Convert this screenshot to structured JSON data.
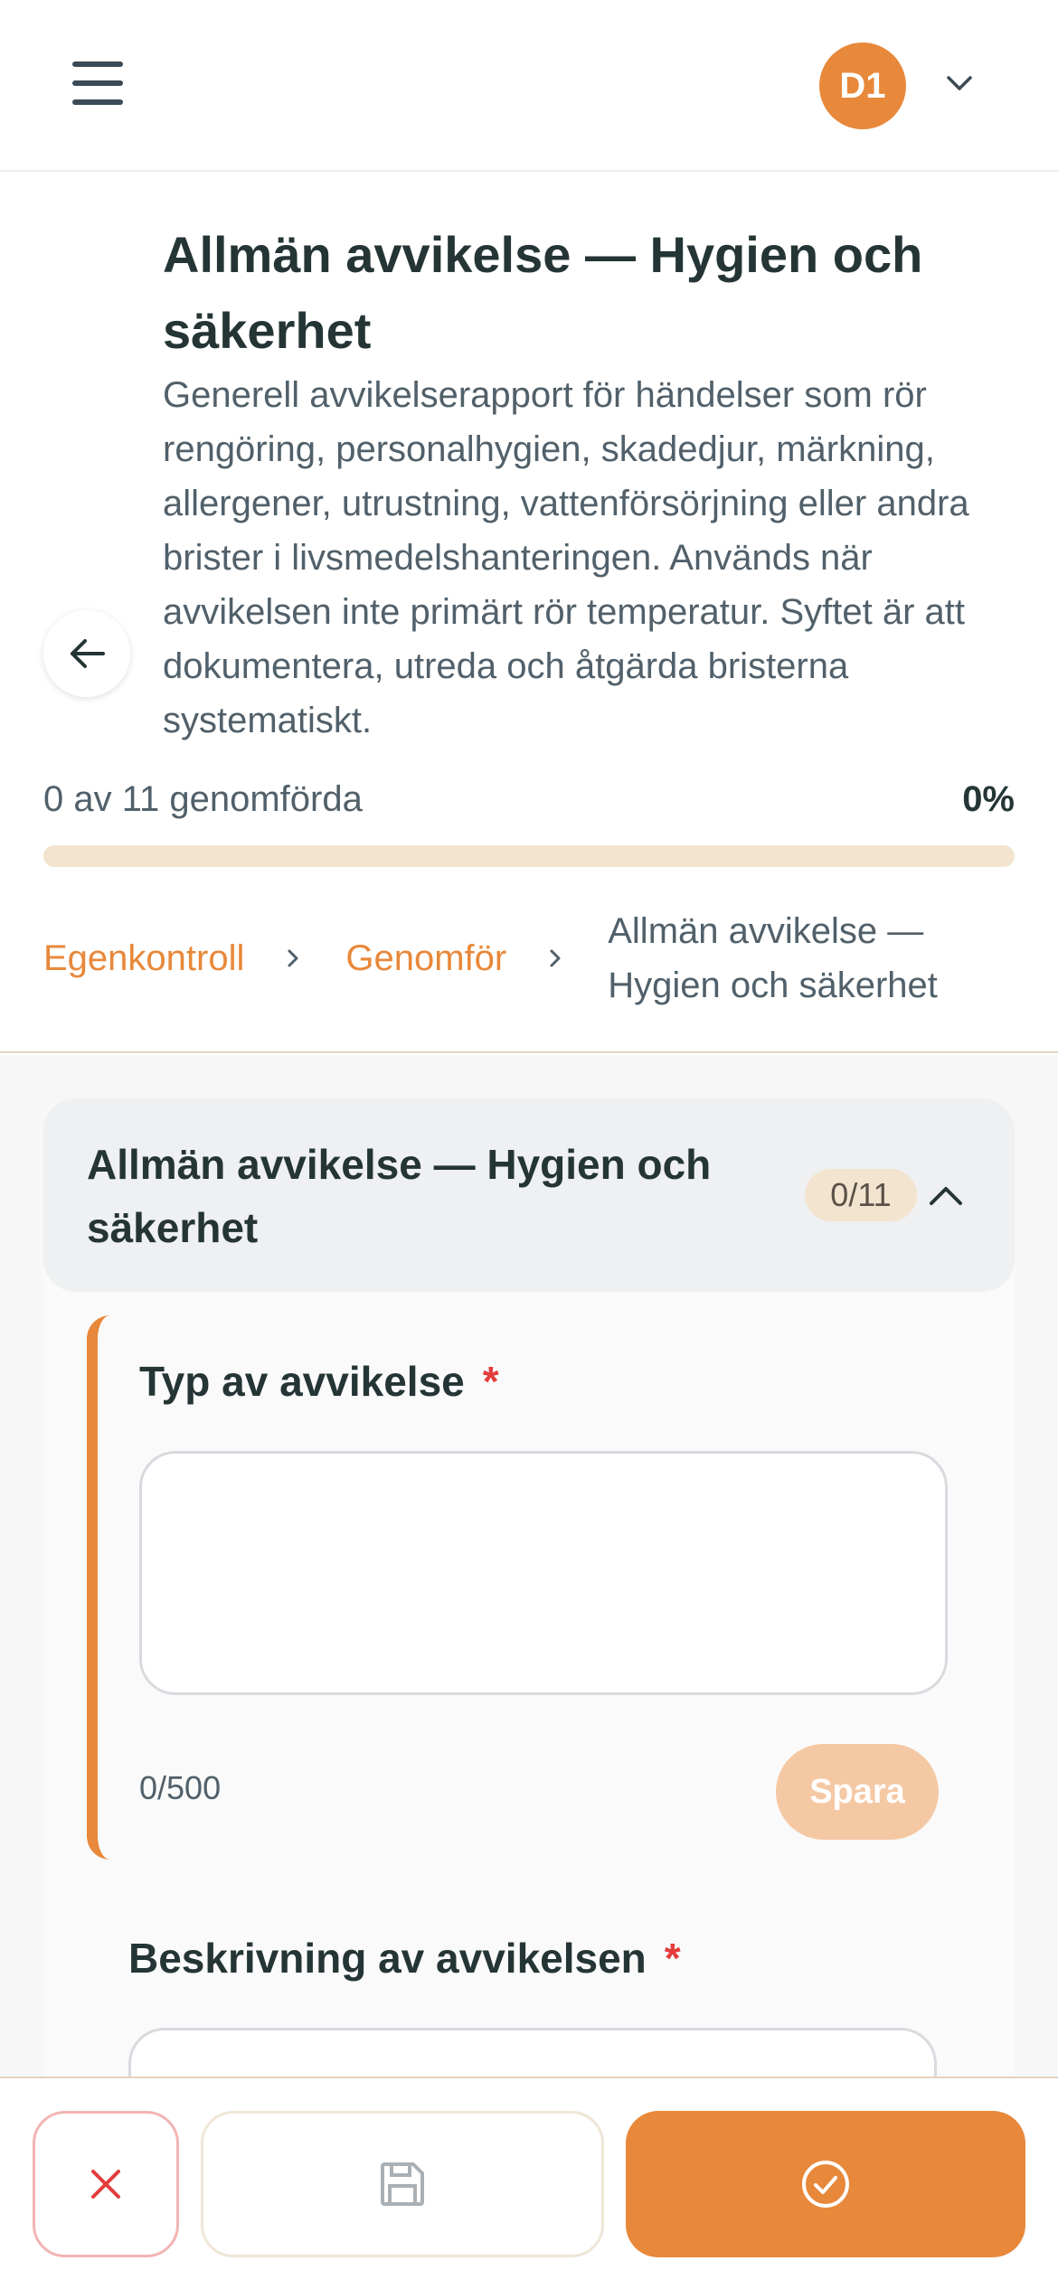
{
  "topbar": {
    "avatar_initials": "D1",
    "menu_icon": "hamburger-menu-icon",
    "dropdown_icon": "chevron-down-icon"
  },
  "header": {
    "title": "Allmän avvikelse — Hygien och säkerhet",
    "description": "Generell avvikelserapport för händelser som rör rengöring, personalhygien, skadedjur, märkning, allergener, utrustning, vattenförsörjning eller andra brister i livsmedelshanteringen. Används när avvikelsen inte primärt rör temperatur. Syftet är att dokumentera, utreda och åtgärda bristerna systematiskt.",
    "progress_label": "0 av 11 genomförda",
    "progress_percent": "0%",
    "progress_fraction": 0
  },
  "breadcrumb": {
    "items": [
      "Egenkontroll",
      "Genomför"
    ],
    "current": "Allmän avvikelse — Hygien och säkerhet"
  },
  "section": {
    "title": "Allmän avvikelse — Hygien och säkerhet",
    "badge": "0/11"
  },
  "fields": [
    {
      "label": "Typ av avvikelse",
      "required_mark": "*",
      "value": "",
      "counter": "0/500",
      "save_label": "Spara"
    },
    {
      "label": "Beskrivning av avvikelsen",
      "required_mark": "*",
      "value": ""
    }
  ],
  "colors": {
    "accent": "#e8883a",
    "required": "#e33c3c",
    "progress_track": "#f3e4cf"
  },
  "bottombar": {
    "cancel_icon": "close-icon",
    "save_icon": "save-icon",
    "submit_icon": "check-circle-icon"
  }
}
